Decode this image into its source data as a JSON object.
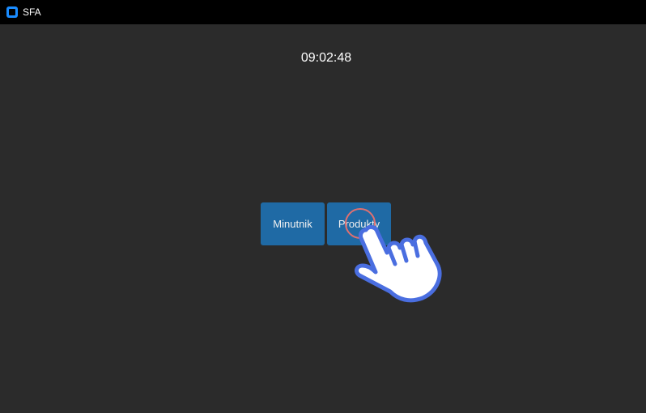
{
  "window": {
    "title": "SFA",
    "icon": "app-icon"
  },
  "main": {
    "clock": "09:02:48",
    "buttons": [
      {
        "label": "Minutnik"
      },
      {
        "label": "Produkty"
      }
    ]
  },
  "overlay": {
    "cursor_icon": "pointing-hand-icon",
    "click_indicator_color": "#e07070",
    "hand_color": "#4a6ee0"
  },
  "colors": {
    "background": "#2b2b2b",
    "titlebar": "#000000",
    "button": "#1f6aa5",
    "app_icon": "#1a8cff"
  }
}
